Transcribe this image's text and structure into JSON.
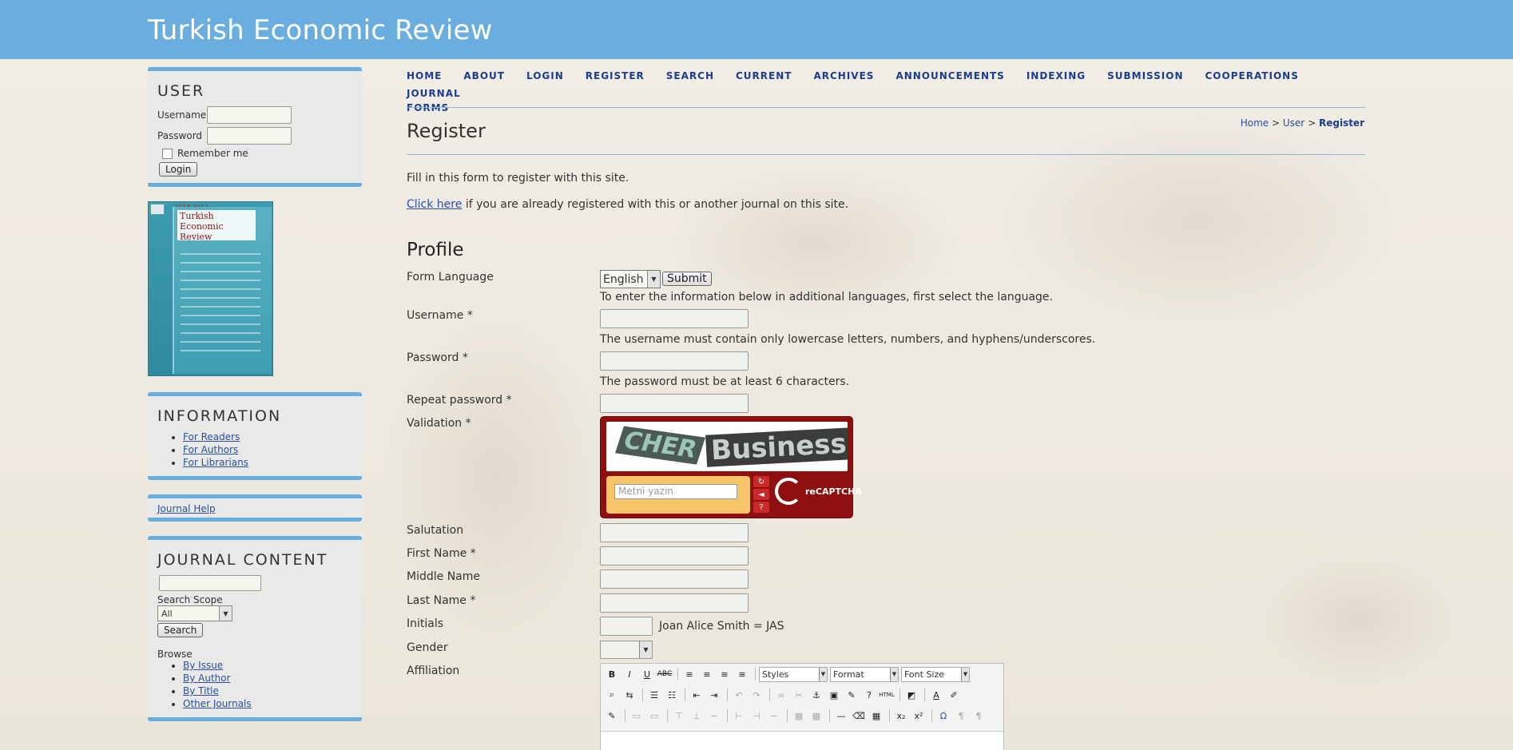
{
  "site": {
    "title": "Turkish Economic Review"
  },
  "user_block": {
    "title": "USER",
    "username_label": "Username",
    "password_label": "Password",
    "remember_label": "Remember me",
    "login_button": "Login"
  },
  "cover": {
    "title": "Turkish Economic Review",
    "year": "2018 2013"
  },
  "information": {
    "title": "INFORMATION",
    "links": [
      "For Readers",
      "For Authors",
      "For Librarians"
    ]
  },
  "journal_help": "Journal Help",
  "journal_content": {
    "title": "JOURNAL CONTENT",
    "search_scope_label": "Search Scope",
    "search_scope_value": "All",
    "search_button": "Search",
    "browse_label": "Browse",
    "browse_links": [
      "By Issue",
      "By Author",
      "By Title",
      "Other Journals"
    ]
  },
  "nav": {
    "items": [
      "HOME",
      "ABOUT",
      "LOGIN",
      "REGISTER",
      "SEARCH",
      "CURRENT",
      "ARCHIVES",
      "ANNOUNCEMENTS",
      "INDEXING",
      "SUBMISSION",
      "COOPERATIONS",
      "JOURNAL FORMS"
    ]
  },
  "page": {
    "title": "Register",
    "breadcrumb": {
      "home": "Home",
      "user": "User",
      "current": "Register",
      "sep": ">"
    },
    "intro": "Fill in this form to register with this site.",
    "click_here": "Click here",
    "already_registered": "if you are already registered with this or another journal on this site."
  },
  "profile": {
    "section_title": "Profile",
    "form_language_label": "Form Language",
    "form_language_value": "English",
    "submit_button": "Submit",
    "language_help": "To enter the information below in additional languages, first select the language.",
    "username_label": "Username *",
    "username_help": "The username must contain only lowercase letters, numbers, and hyphens/underscores.",
    "password_label": "Password *",
    "password_help": "The password must be at least 6 characters.",
    "repeat_password_label": "Repeat password *",
    "validation_label": "Validation *",
    "salutation_label": "Salutation",
    "first_name_label": "First Name *",
    "middle_name_label": "Middle Name",
    "last_name_label": "Last Name *",
    "initials_label": "Initials",
    "initials_example": "Joan Alice Smith = JAS",
    "gender_label": "Gender",
    "affiliation_label": "Affiliation"
  },
  "captcha": {
    "word1": "CHER",
    "word2": "Business",
    "placeholder": "Metni yazın",
    "logo_text": "reCAPTCHA"
  },
  "editor": {
    "styles": "Styles",
    "format": "Format",
    "font_size": "Font Size"
  },
  "colors": {
    "header": "#6aaee0",
    "nav_text": "#1b3d8f",
    "link": "#2b4fa3",
    "captcha_bg": "#8e0f0f"
  }
}
